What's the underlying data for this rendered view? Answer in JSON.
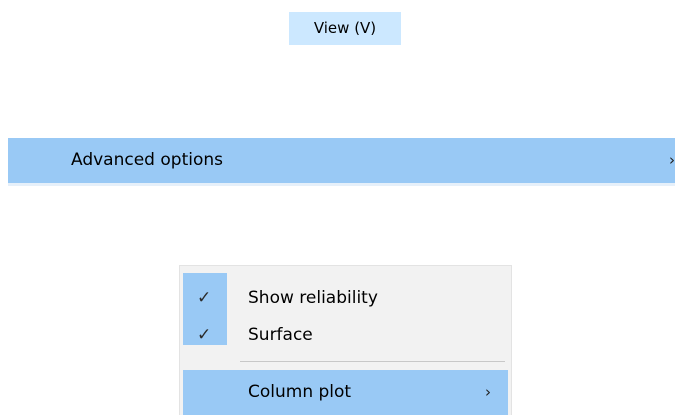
{
  "menubar": {
    "view_label": "View (V)"
  },
  "menu": {
    "advanced_options": {
      "label": "Advanced options",
      "chevron": "›",
      "chevron_icon": "chevron-right-icon",
      "highlighted": true
    }
  },
  "submenu": {
    "items": [
      {
        "label": "Show reliability",
        "checked": true,
        "check_glyph": "✓",
        "check_icon": "checkmark-icon"
      },
      {
        "label": "Surface",
        "checked": true,
        "check_glyph": "✓",
        "check_icon": "checkmark-icon"
      }
    ],
    "column_plot": {
      "label": "Column plot",
      "chevron": "›",
      "chevron_icon": "chevron-right-icon",
      "highlighted": true
    }
  },
  "colors": {
    "menu_title_highlight": "#cce8ff",
    "selection": "#99c9f5",
    "submenu_background": "#f2f2f2",
    "separator": "#c8c8c8"
  }
}
